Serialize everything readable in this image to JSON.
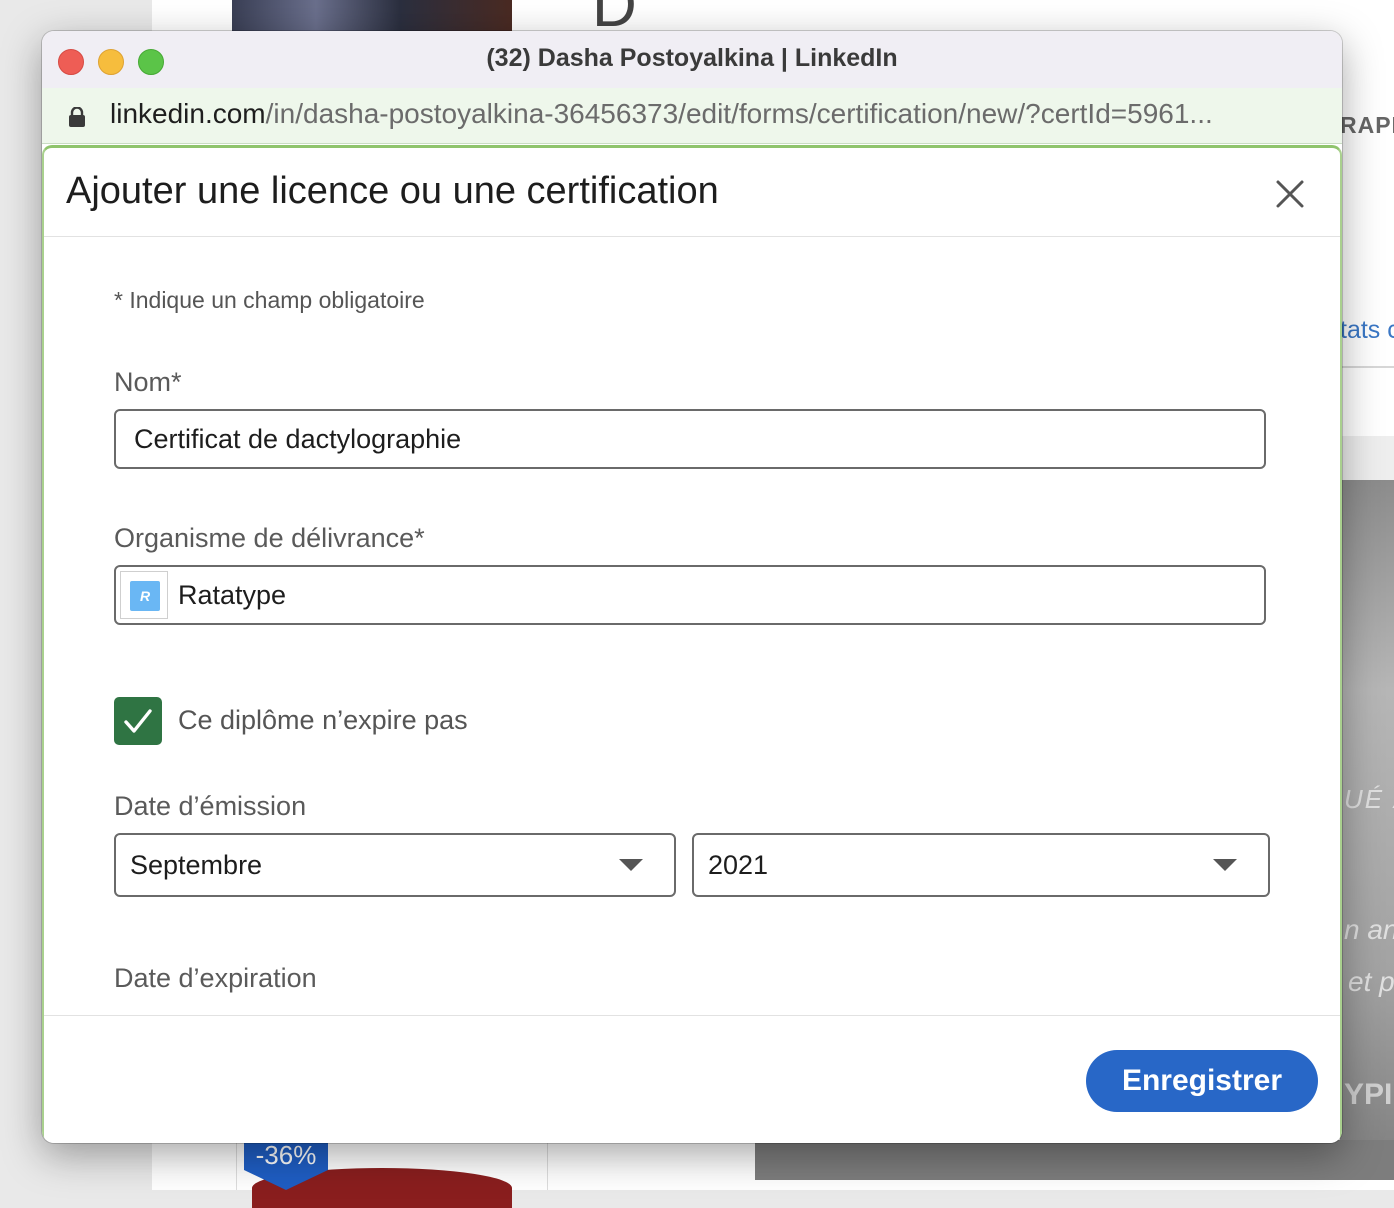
{
  "background": {
    "letter": "D",
    "right_text_top": "RAPP",
    "right_link": "tats c",
    "cert_line1": "UÉ À",
    "cert_line2": "n an",
    "cert_line3": "et p",
    "cert_brand": "YPI",
    "discount_badge": "-36%"
  },
  "window": {
    "title": "(32) Dasha Postoyalkina | LinkedIn",
    "url_domain": "linkedin.com",
    "url_path": "/in/dasha-postoyalkina-36456373/edit/forms/certification/new/?certId=5961..."
  },
  "modal": {
    "title": "Ajouter une licence ou une certification",
    "required_note": "* Indique un champ obligatoire",
    "name_label": "Nom*",
    "name_value": "Certificat de dactylographie",
    "org_label": "Organisme de délivrance*",
    "org_value": "Ratatype",
    "org_logo_letter": "R",
    "no_expire_checked": true,
    "no_expire_label": "Ce diplôme n’expire pas",
    "issue_date_label": "Date d’émission",
    "issue_month": "Septembre",
    "issue_year": "2021",
    "expiry_date_label": "Date d’expiration",
    "save_label": "Enregistrer"
  },
  "colors": {
    "save_button": "#2867c7",
    "checkbox": "#2f7443",
    "modal_border": "#a9d08e"
  }
}
